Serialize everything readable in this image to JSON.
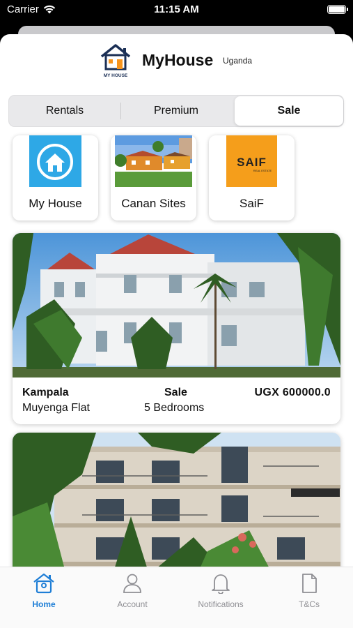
{
  "status_bar": {
    "carrier": "Carrier",
    "time": "11:15 AM",
    "battery_level": 1.0
  },
  "header": {
    "title": "MyHouse",
    "country": "Uganda",
    "logo_text": "MY HOUSE"
  },
  "segments": {
    "items": [
      "Rentals",
      "Premium",
      "Sale"
    ],
    "selected": "Sale"
  },
  "agents": [
    {
      "name": "My House"
    },
    {
      "name": "Canan Sites"
    },
    {
      "name": "SaiF",
      "logo_text": "SAIF",
      "logo_sub": "REAL ESTATE"
    }
  ],
  "listings": [
    {
      "city": "Kampala",
      "type": "Sale",
      "price": "UGX  600000.0",
      "place": "Muyenga Flat",
      "bedrooms": "5 Bedrooms"
    },
    {
      "city": "",
      "type": "",
      "price": "",
      "place": "",
      "bedrooms": ""
    }
  ],
  "tabs": [
    {
      "label": "Home",
      "icon": "home-icon",
      "active": true
    },
    {
      "label": "Account",
      "icon": "person-icon",
      "active": false
    },
    {
      "label": "Notifications",
      "icon": "bell-icon",
      "active": false
    },
    {
      "label": "T&Cs",
      "icon": "document-icon",
      "active": false
    }
  ],
  "colors": {
    "accent": "#1e7ed6",
    "my_house_tile": "#2ea8e6",
    "saif_tile": "#f59e1b"
  }
}
